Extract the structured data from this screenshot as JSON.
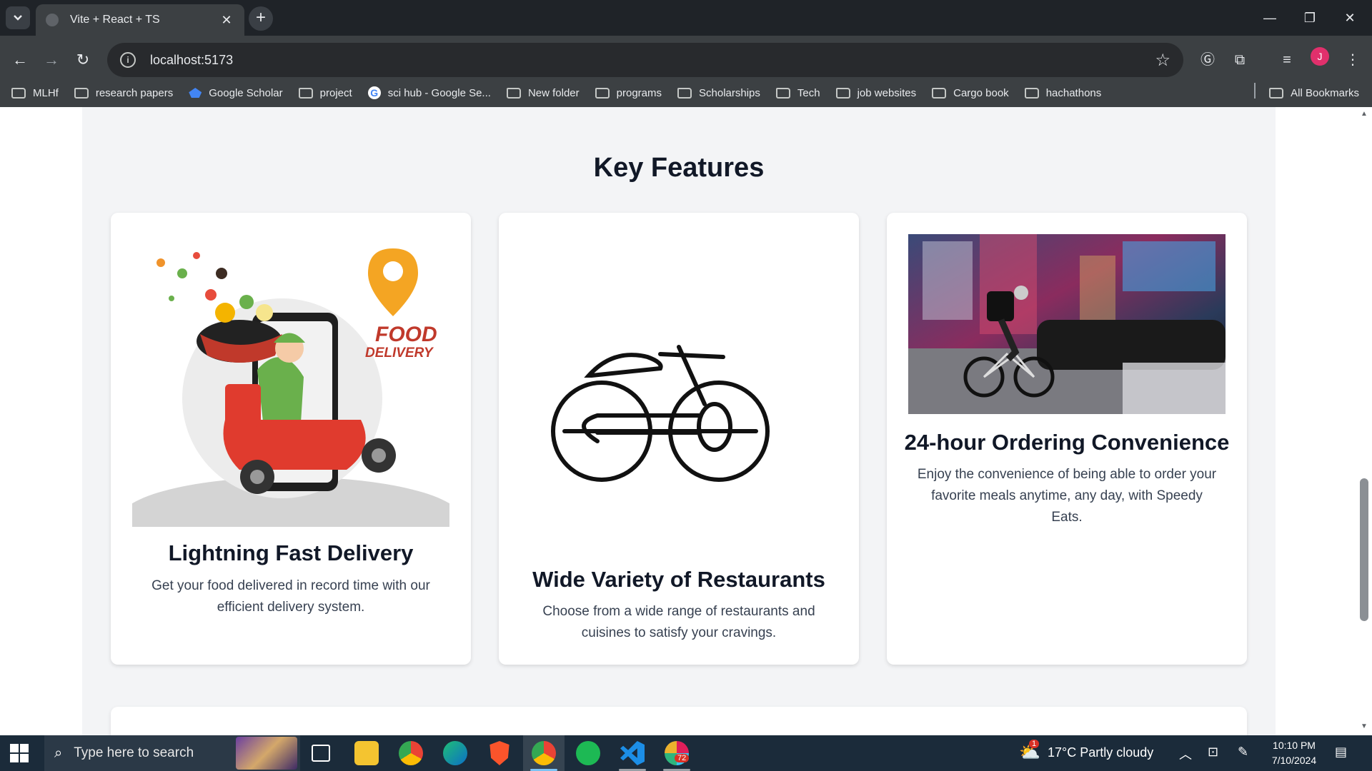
{
  "browser": {
    "tab_title": "Vite + React + TS",
    "url": "localhost:5173",
    "avatar_initial": "J",
    "bookmarks": [
      "MLHf",
      "research papers",
      "Google Scholar",
      "project",
      "sci hub - Google Se...",
      "New folder",
      "programs",
      "Scholarships",
      "Tech",
      "job websites",
      "Cargo book",
      "hachathons"
    ],
    "all_bookmarks": "All Bookmarks"
  },
  "page": {
    "section_title": "Key Features",
    "cards": [
      {
        "title": "Lightning Fast Delivery",
        "description": "Get your food delivered in record time with our efficient delivery system.",
        "image_text_1": "FOOD",
        "image_text_2": "DELIVERY"
      },
      {
        "title": "Wide Variety of Restaurants",
        "description": "Choose from a wide range of restaurants and cuisines to satisfy your cravings."
      },
      {
        "title": "24-hour Ordering Convenience",
        "description": "Enjoy the convenience of being able to order your favorite meals anytime, any day, with Speedy Eats."
      }
    ]
  },
  "taskbar": {
    "search_placeholder": "Type here to search",
    "weather": "17°C  Partly cloudy",
    "weather_badge": "1",
    "slack_badge": "72",
    "time": "10:10 PM",
    "date": "7/10/2024"
  }
}
